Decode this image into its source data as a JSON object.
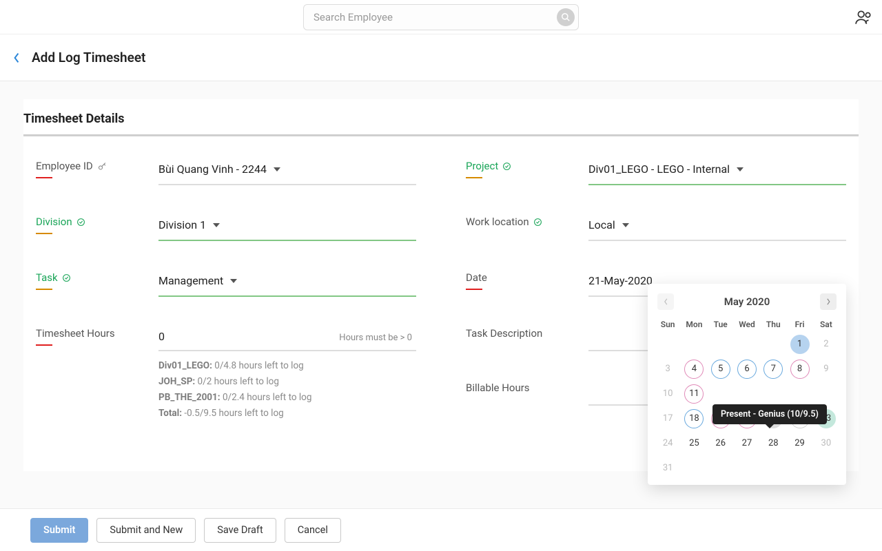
{
  "search": {
    "placeholder": "Search Employee"
  },
  "page": {
    "title": "Add Log Timesheet",
    "section": "Timesheet Details"
  },
  "fields": {
    "employee_id": {
      "label": "Employee ID",
      "value": "Bùi Quang Vinh - 2244"
    },
    "division": {
      "label": "Division",
      "value": "Division 1"
    },
    "task": {
      "label": "Task",
      "value": "Management"
    },
    "hours": {
      "label": "Timesheet Hours",
      "value": "0",
      "hint": "Hours must be > 0"
    },
    "project": {
      "label": "Project",
      "value": "Div01_LEGO - LEGO - Internal"
    },
    "work_loc": {
      "label": "Work location",
      "value": "Local"
    },
    "date": {
      "label": "Date",
      "value": "21-May-2020"
    },
    "task_desc": {
      "label": "Task Description"
    },
    "billable": {
      "label": "Billable Hours"
    }
  },
  "hours_notes": [
    {
      "label": "Div01_LEGO:",
      "text": " 0/4.8 hours left to log"
    },
    {
      "label": "JOH_SP:",
      "text": " 0/2 hours left to log"
    },
    {
      "label": "PB_THE_2001:",
      "text": " 0/2.4 hours left to log"
    },
    {
      "label": "Total:",
      "text": " -0.5/9.5 hours left to log"
    }
  ],
  "calendar": {
    "month": "May 2020",
    "dow": [
      "Sun",
      "Mon",
      "Tue",
      "Wed",
      "Thu",
      "Fri",
      "Sat"
    ],
    "tooltip": "Present - Genius (10/9.5)",
    "weeks": [
      [
        null,
        null,
        null,
        null,
        null,
        {
          "d": 1,
          "cls": "fill-blue"
        },
        {
          "d": 2,
          "cls": "muted"
        }
      ],
      [
        {
          "d": 3,
          "cls": "muted"
        },
        {
          "d": 4,
          "cls": "ring-pink"
        },
        {
          "d": 5,
          "cls": "ring-blue"
        },
        {
          "d": 6,
          "cls": "ring-blue"
        },
        {
          "d": 7,
          "cls": "ring-blue"
        },
        {
          "d": 8,
          "cls": "ring-pink"
        },
        {
          "d": 9,
          "cls": "muted"
        }
      ],
      [
        {
          "d": 10,
          "cls": "muted"
        },
        {
          "d": 11,
          "cls": "ring-pink"
        },
        null,
        null,
        null,
        null,
        null
      ],
      [
        {
          "d": 17,
          "cls": "muted"
        },
        {
          "d": 18,
          "cls": "ring-blue"
        },
        {
          "d": 19,
          "cls": "ring-pink"
        },
        {
          "d": 20,
          "cls": "ring-pink"
        },
        {
          "d": 21,
          "cls": "fill-grey"
        },
        {
          "d": 22,
          "cls": "ring-grey"
        },
        {
          "d": 23,
          "cls": "fill-mint"
        }
      ],
      [
        {
          "d": 24,
          "cls": "muted"
        },
        {
          "d": 25
        },
        {
          "d": 26
        },
        {
          "d": 27
        },
        {
          "d": 28
        },
        {
          "d": 29
        },
        {
          "d": 30,
          "cls": "muted"
        }
      ],
      [
        {
          "d": 31,
          "cls": "muted"
        },
        null,
        null,
        null,
        null,
        null,
        null
      ]
    ]
  },
  "actions": {
    "submit": "Submit",
    "submit_new": "Submit and New",
    "save_draft": "Save Draft",
    "cancel": "Cancel"
  }
}
